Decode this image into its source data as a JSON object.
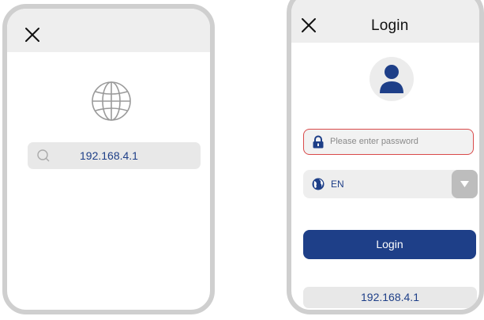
{
  "left_screen": {
    "close_icon": "close-icon",
    "globe_icon": "globe-icon",
    "search": {
      "icon": "search-icon",
      "value": "192.168.4.1"
    }
  },
  "right_screen": {
    "close_icon": "close-icon",
    "title": "Login",
    "avatar_icon": "user-avatar-icon",
    "password": {
      "icon": "lock-icon",
      "placeholder": "Please enter password",
      "value": ""
    },
    "language": {
      "icon": "globe-icon",
      "selected": "EN",
      "dropdown_icon": "triangle-down-icon"
    },
    "login_button_label": "Login",
    "ip_address": "192.168.4.1"
  },
  "colors": {
    "primary_blue": "#1e3f88",
    "error_red": "#d94a4a",
    "frame_gray": "#cfcfcf",
    "header_gray": "#eeeeee"
  }
}
